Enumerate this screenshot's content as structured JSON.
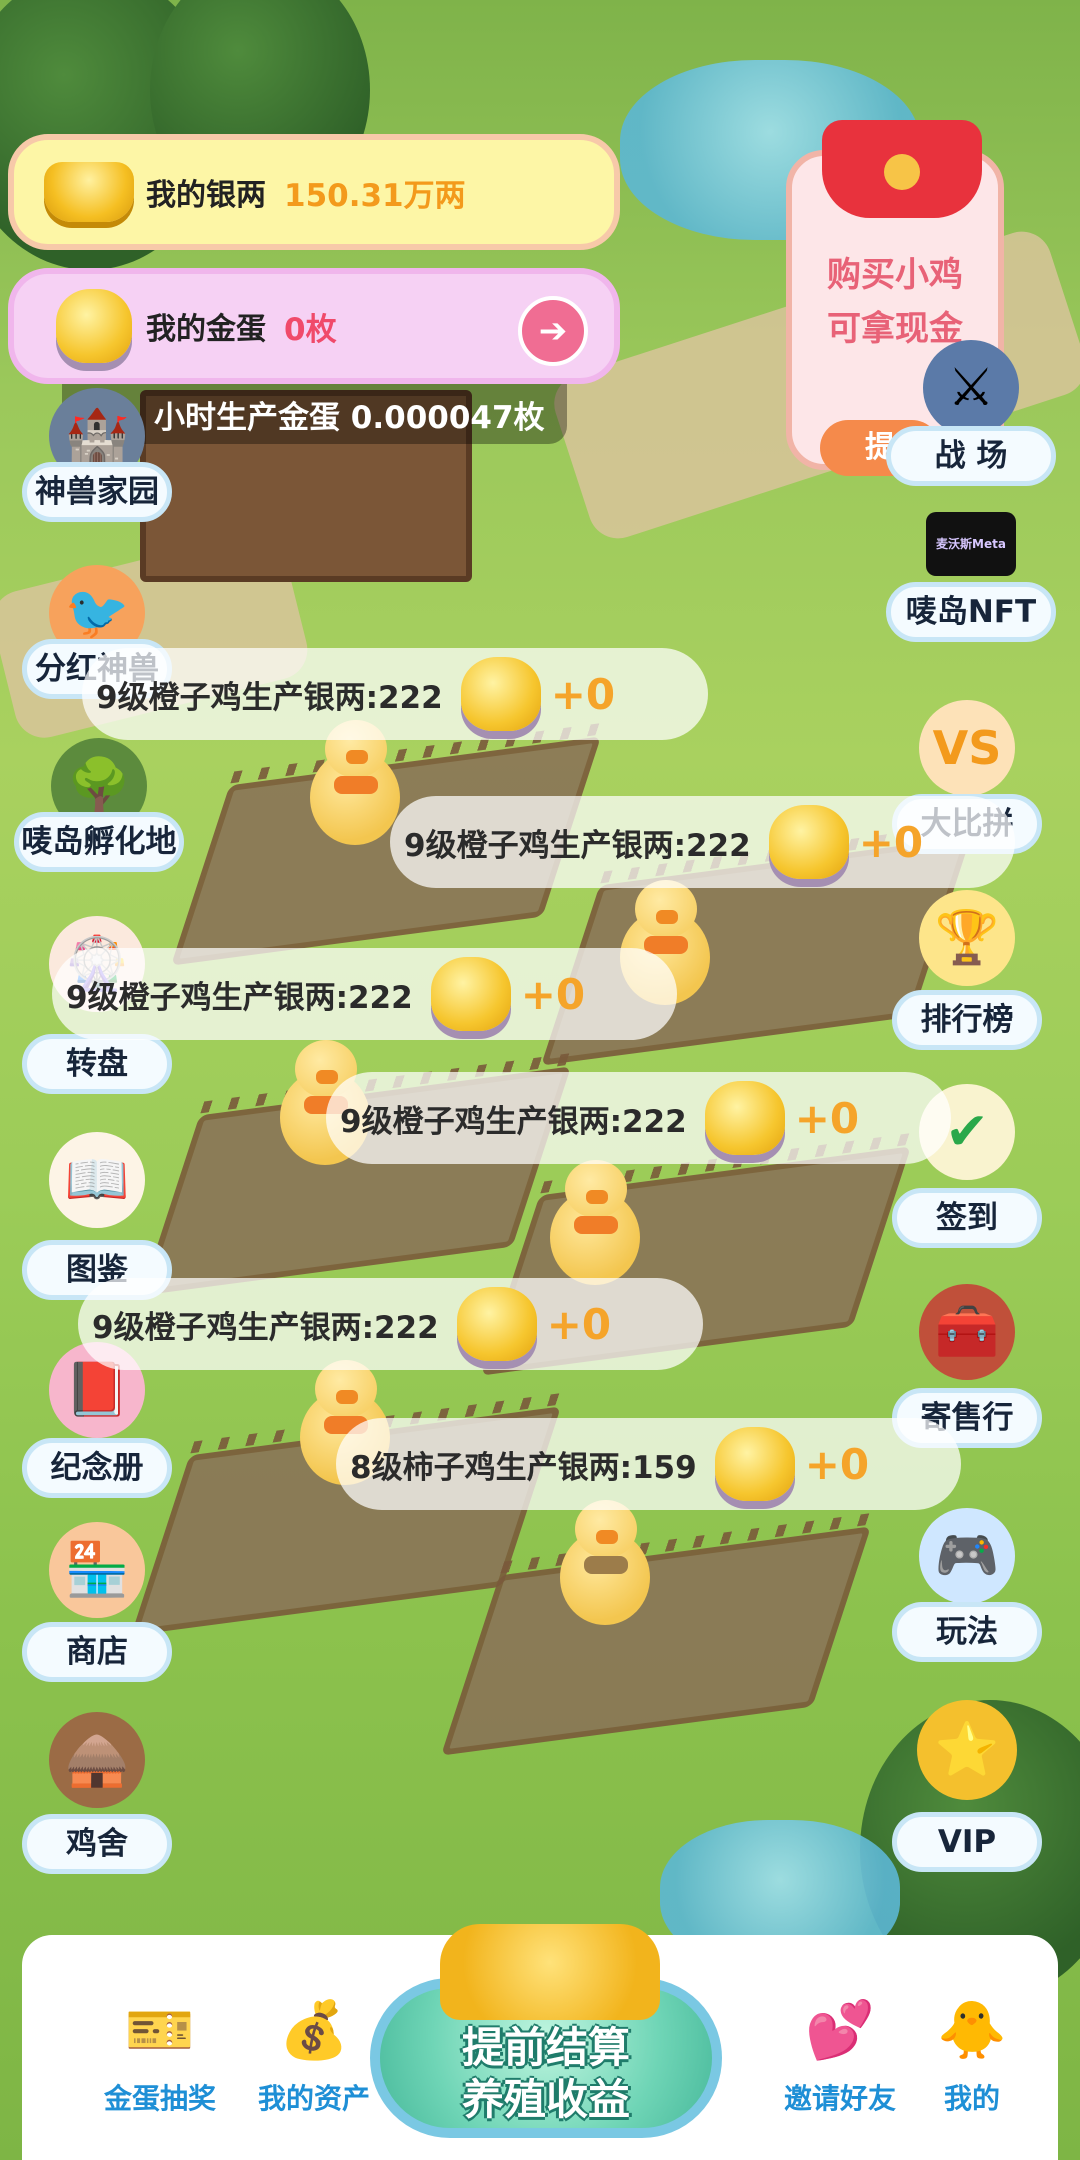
{
  "silver": {
    "label": "我的银两",
    "value": "150.31万两"
  },
  "gold_egg": {
    "label": "我的金蛋",
    "value": "0枚",
    "arrow": "➔"
  },
  "hourly": {
    "text": "小时生产金蛋 0.000047枚"
  },
  "buy_card": {
    "line1": "购买小鸡",
    "line2": "可拿现金",
    "button": "提"
  },
  "left_menu": [
    {
      "name": "home",
      "label": "神兽家园",
      "icon": "castle-icon"
    },
    {
      "name": "dividend",
      "label": "分红神兽",
      "icon": "phoenix-icon"
    },
    {
      "name": "hatch",
      "label": "唛岛孵化地",
      "icon": "nest-icon"
    },
    {
      "name": "wheel",
      "label": "转盘",
      "icon": "wheel-icon"
    },
    {
      "name": "album",
      "label": "图鉴",
      "icon": "book-icon"
    },
    {
      "name": "memorial",
      "label": "纪念册",
      "icon": "album-icon"
    },
    {
      "name": "shop",
      "label": "商店",
      "icon": "shop-icon"
    },
    {
      "name": "coop",
      "label": "鸡舍",
      "icon": "coop-icon"
    }
  ],
  "right_menu": [
    {
      "name": "battle",
      "label": "战  场",
      "icon": "swords-icon"
    },
    {
      "name": "nft",
      "label": "唛岛NFT",
      "icon": "meta-icon",
      "badge": "麦沃斯Meta"
    },
    {
      "name": "compete",
      "label": "大比拼",
      "icon": "vs-icon"
    },
    {
      "name": "rank",
      "label": "排行榜",
      "icon": "trophy-icon"
    },
    {
      "name": "signin",
      "label": "签到",
      "icon": "checklist-icon"
    },
    {
      "name": "consign",
      "label": "寄售行",
      "icon": "chest-icon"
    },
    {
      "name": "gameplay",
      "label": "玩法",
      "icon": "gamepad-icon"
    },
    {
      "name": "vip",
      "label": "VIP",
      "icon": "star-medal-icon"
    }
  ],
  "production": [
    {
      "text": "9级橙子鸡生产银两:222",
      "plus": "+0"
    },
    {
      "text": "9级橙子鸡生产银两:222",
      "plus": "+0"
    },
    {
      "text": "9级橙子鸡生产银两:222",
      "plus": "+0"
    },
    {
      "text": "9级橙子鸡生产银两:222",
      "plus": "+0"
    },
    {
      "text": "9级橙子鸡生产银两:222",
      "plus": "+0"
    },
    {
      "text": "8级柿子鸡生产银两:159",
      "plus": "+0"
    }
  ],
  "bottom": {
    "tabs": [
      {
        "label": "金蛋抽奖",
        "icon": "ticket-icon"
      },
      {
        "label": "我的资产",
        "icon": "money-bag-icon"
      },
      {
        "label": "邀请好友",
        "icon": "hearts-icon"
      },
      {
        "label": "我的",
        "icon": "chick-avatar-icon"
      }
    ],
    "settle_line1": "提前结算",
    "settle_line2": "养殖收益"
  }
}
